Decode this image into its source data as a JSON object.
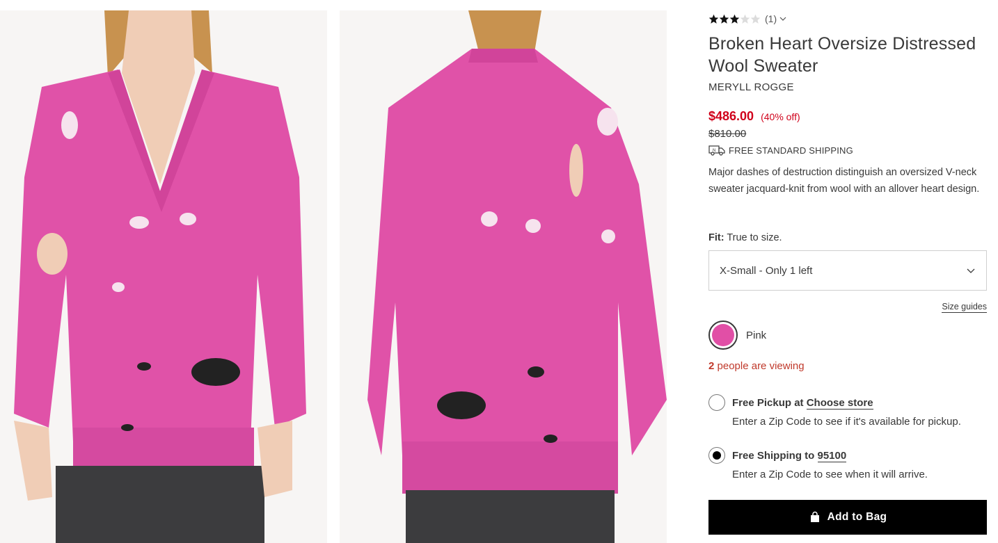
{
  "product": {
    "rating": {
      "stars_filled": 3,
      "stars_total": 5,
      "review_count": "(1)"
    },
    "title": "Broken Heart Oversize Distressed Wool Sweater",
    "brand": "MERYLL ROGGE",
    "price": "$486.00",
    "discount": "(40% off)",
    "original_price": "$810.00",
    "shipping_badge": "FREE STANDARD SHIPPING",
    "description": "Major dashes of destruction distinguish an oversized V-neck sweater jacquard-knit from wool with an allover heart design."
  },
  "fit": {
    "label": "Fit:",
    "value": "True to size."
  },
  "size": {
    "selected": "X-Small - Only 1 left",
    "guides_label": "Size guides"
  },
  "color": {
    "name": "Pink",
    "swatch_hex": "#e14fa6"
  },
  "viewing": {
    "count": "2",
    "text": " people are viewing"
  },
  "delivery": {
    "pickup": {
      "prefix": "Free Pickup at ",
      "link": "Choose store",
      "sub": "Enter a Zip Code to see if it's available for pickup.",
      "selected": false
    },
    "shipping": {
      "prefix": "Free Shipping to ",
      "link": "95100",
      "sub": "Enter a Zip Code to see when it will arrive.",
      "selected": true
    }
  },
  "add_to_bag": "Add to Bag",
  "colors": {
    "sale_red": "#d0021b",
    "sweater_pink": "#e14fa6",
    "text": "#393939",
    "button_black": "#000000"
  }
}
